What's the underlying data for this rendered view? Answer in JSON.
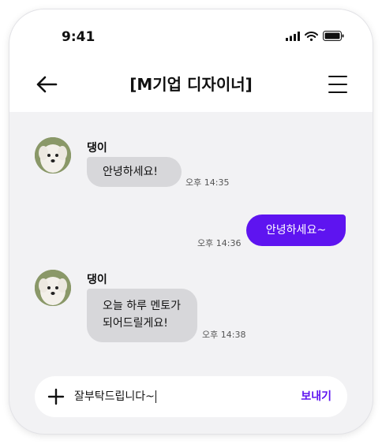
{
  "status_bar": {
    "time": "9:41",
    "icons": [
      "signal-icon",
      "wifi-icon",
      "battery-icon"
    ]
  },
  "nav": {
    "back_icon": "arrow-left-icon",
    "title": "[M기업 디자이너]",
    "menu_icon": "hamburger-menu-icon"
  },
  "messages": [
    {
      "direction": "incoming",
      "sender": "댕이",
      "lines": [
        "안녕하세요!"
      ],
      "time": "오후 14:35"
    },
    {
      "direction": "outgoing",
      "lines": [
        "안녕하세요~"
      ],
      "time": "오후 14:36"
    },
    {
      "direction": "incoming",
      "sender": "댕이",
      "lines": [
        "오늘 하루 멘토가",
        "되어드릴게요!"
      ],
      "time": "오후 14:38"
    }
  ],
  "composer": {
    "plus_icon": "plus-icon",
    "value": "잘부탁드립니다~",
    "send_label": "보내기"
  },
  "colors": {
    "accent": "#5e14f0",
    "incoming_bubble": "#d7d7da",
    "chat_background": "#f2f2f4"
  }
}
